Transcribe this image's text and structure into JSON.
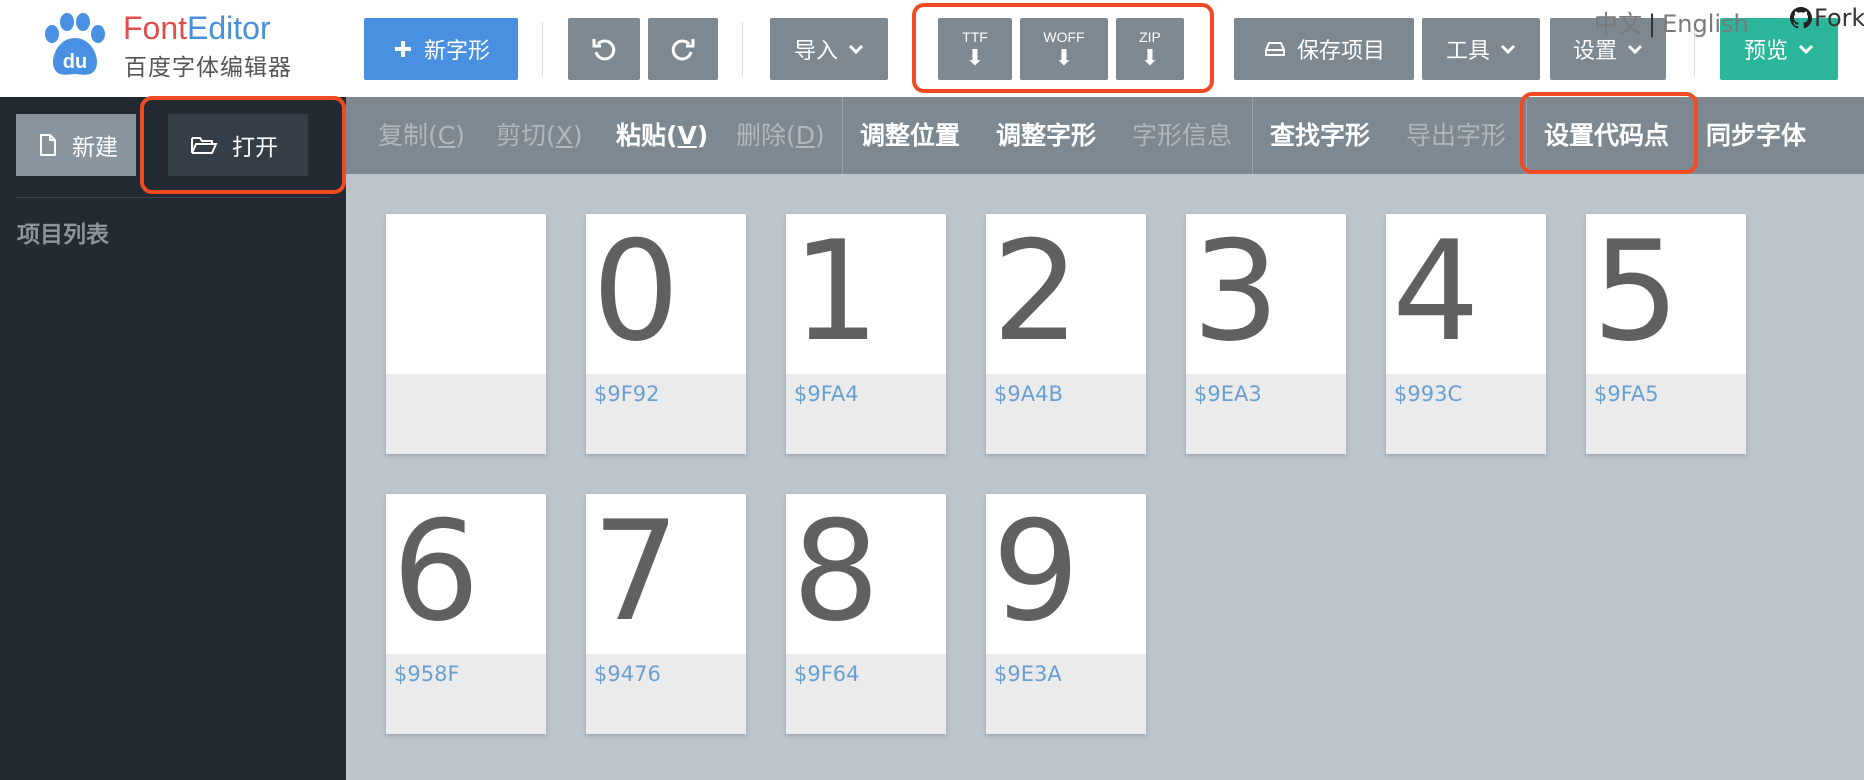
{
  "logo": {
    "title_part1": "Font",
    "title_part2": "Editor",
    "subtitle": "百度字体编辑器",
    "badge": "du"
  },
  "toolbar": {
    "new_glyph": "新字形",
    "undo_icon": "undo-icon",
    "redo_icon": "redo-icon",
    "import": "导入",
    "export_ttf": "TTF",
    "export_woff": "WOFF",
    "export_zip": "ZIP",
    "save_project": "保存项目",
    "tools": "工具",
    "settings": "设置",
    "preview": "预览"
  },
  "lang": {
    "zh": "中文",
    "sep": "|",
    "en": "English"
  },
  "fork": "Fork",
  "sidebar": {
    "new": "新建",
    "open": "打开",
    "project_list": "项目列表"
  },
  "menu": {
    "copy": "复制",
    "copy_key": "C",
    "cut": "剪切",
    "cut_key": "X",
    "paste": "粘贴",
    "paste_key": "V",
    "delete": "删除",
    "delete_key": "D",
    "adjust_pos": "调整位置",
    "adjust_glyph": "调整字形",
    "glyph_info": "字形信息",
    "find_glyph": "查找字形",
    "export_glyph": "导出字形",
    "set_codepoint": "设置代码点",
    "sync_font": "同步字体"
  },
  "glyphs": [
    {
      "char": "",
      "code": ""
    },
    {
      "char": "0",
      "code": "$9F92"
    },
    {
      "char": "1",
      "code": "$9FA4"
    },
    {
      "char": "2",
      "code": "$9A4B"
    },
    {
      "char": "3",
      "code": "$9EA3"
    },
    {
      "char": "4",
      "code": "$993C"
    },
    {
      "char": "5",
      "code": "$9FA5"
    },
    {
      "char": "6",
      "code": "$958F"
    },
    {
      "char": "7",
      "code": "$9476"
    },
    {
      "char": "8",
      "code": "$9F64"
    },
    {
      "char": "9",
      "code": "$9E3A"
    }
  ],
  "colors": {
    "primary": "#4a90e2",
    "teal": "#2bb59a",
    "highlight": "#f04b22",
    "sidebar": "#232a31",
    "menu": "#7d8891"
  }
}
